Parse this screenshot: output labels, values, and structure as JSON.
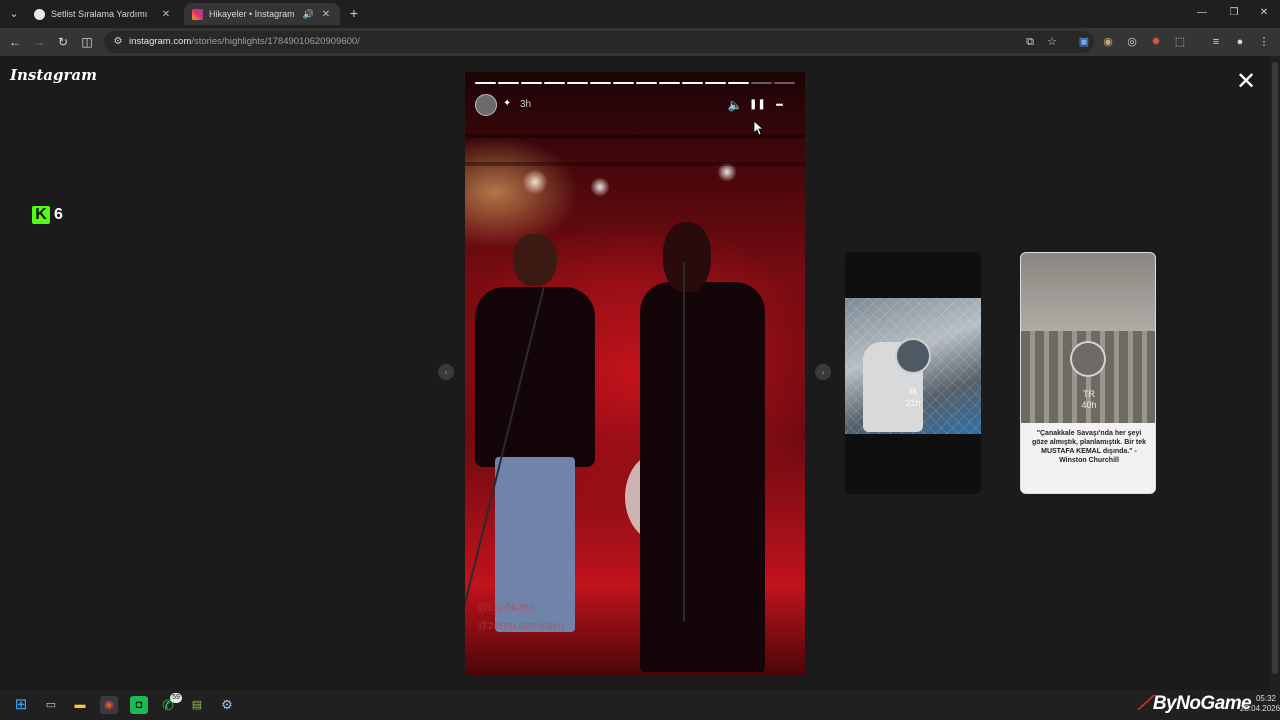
{
  "browser": {
    "tabs": [
      {
        "title": "Setlist Sıralama Yardımı",
        "close": "✕"
      },
      {
        "title": "Hikayeler • Instagram",
        "close": "✕",
        "audio_icon": "speaker-icon"
      }
    ],
    "new_tab": "+",
    "url_host": "instagram.com",
    "url_path": "/stories/highlights/17849010620909600/",
    "window_controls": {
      "minimize": "—",
      "maximize": "❐",
      "close": "✕"
    }
  },
  "instagram": {
    "logo": "Instagram",
    "close": "✕",
    "kick_widget": {
      "icon": "K",
      "count": "6"
    },
    "story": {
      "time": "3h",
      "segments_total": 14,
      "segments_viewed": 12,
      "watermark_line1": "@canfikitfte",
      "watermark_line2": "@zehra.demirdvn",
      "controls": {
        "mute": "🔈",
        "pause": "❚❚",
        "more": "•••"
      }
    },
    "previews": [
      {
        "name": "ilk",
        "time": "21h"
      },
      {
        "name": "TR",
        "time": "40h",
        "quote": "\"Çanakkale Savaşı'nda her şeyi göze almıştık, planlamıştık. Bir tek MUSTAFA KEMAL dışında.\" -Winston Churchill"
      }
    ],
    "nav": {
      "prev": "‹",
      "next": "›"
    }
  },
  "taskbar": {
    "whatsapp_badge": "59",
    "brand": "ByNoGame",
    "time": "05:32",
    "date": "28.04.2026"
  },
  "colors": {
    "kick_green": "#53fc18",
    "stage": "#1b1b1b",
    "brand_red": "#d32f2f"
  }
}
